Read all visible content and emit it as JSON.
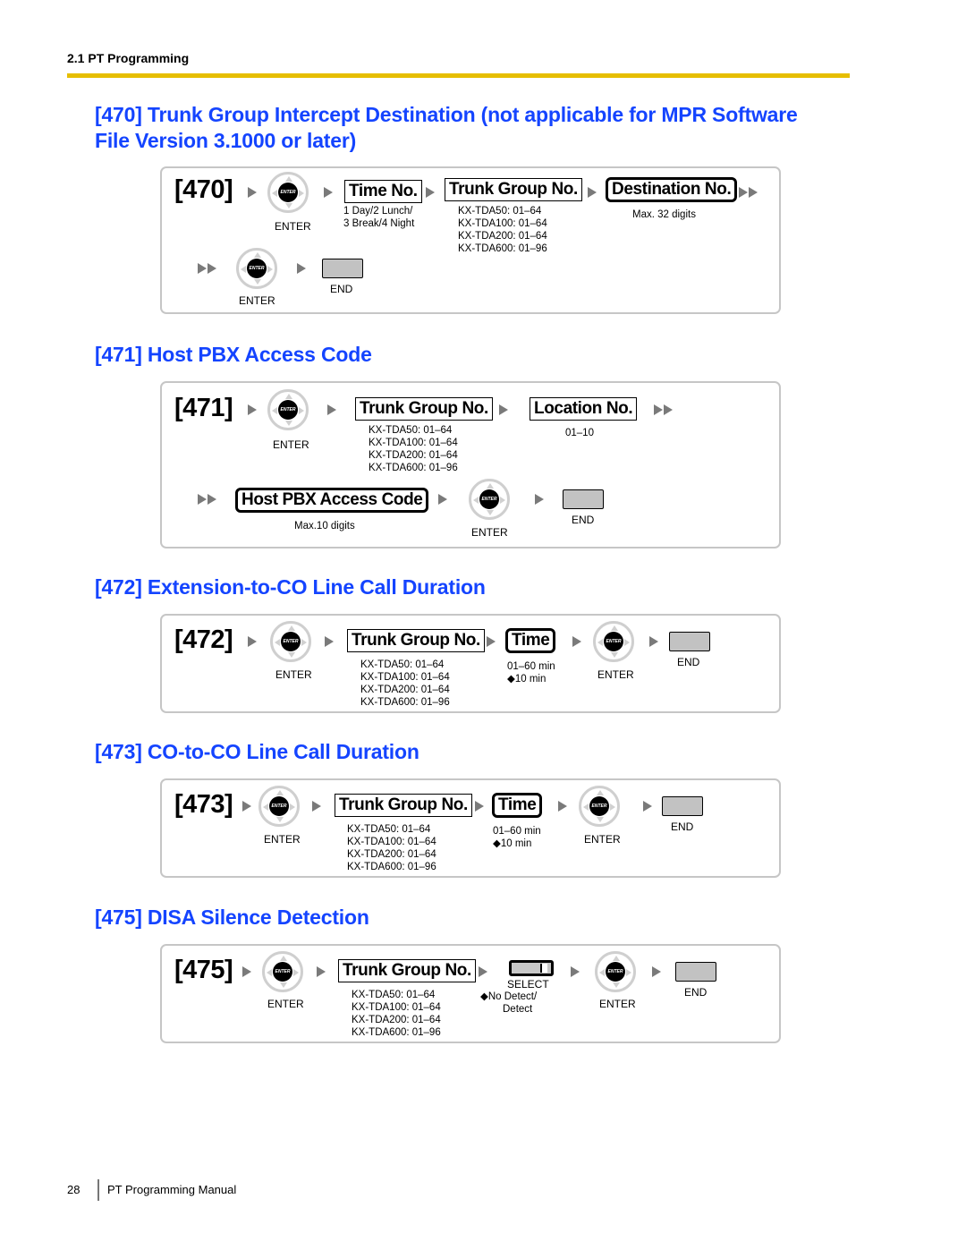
{
  "header": {
    "running_head": "2.1 PT Programming",
    "accent_color": "#e6be00",
    "title_color": "#1444ff"
  },
  "common": {
    "enter": "ENTER",
    "enter_key_glyph": "ENTER",
    "end": "END",
    "trunk_group_no": "Trunk Group No.",
    "trunk_ranges": [
      "KX-TDA50: 01–64",
      "KX-TDA100: 01–64",
      "KX-TDA200: 01–64",
      "KX-TDA600: 01–96"
    ]
  },
  "s470": {
    "title_line1": "[470] Trunk Group Intercept Destination (not applicable for MPR Software",
    "title_line2": "File Version 3.1000 or later)",
    "code": "[470]",
    "time_no": "Time No.",
    "time_no_desc": [
      "1 Day/2 Lunch/",
      "3 Break/4 Night"
    ],
    "destination_no": "Destination No.",
    "destination_desc": "Max. 32 digits"
  },
  "s471": {
    "title": "[471] Host PBX Access Code",
    "code": "[471]",
    "location_no": "Location No.",
    "location_desc": "01–10",
    "host_code": "Host PBX Access Code",
    "host_code_desc": "Max.10 digits"
  },
  "s472": {
    "title": "[472] Extension-to-CO Line Call Duration",
    "code": "[472]",
    "time": "Time",
    "time_desc": [
      "01–60 min",
      "◆10 min"
    ]
  },
  "s473": {
    "title": "[473] CO-to-CO Line Call Duration",
    "code": "[473]",
    "time": "Time",
    "time_desc": [
      "01–60 min",
      "◆10 min"
    ]
  },
  "s475": {
    "title": "[475] DISA Silence Detection",
    "code": "[475]",
    "select": "SELECT",
    "select_desc": [
      "◆No Detect/",
      "Detect"
    ]
  },
  "footer": {
    "page_number": "28",
    "manual_title": "PT Programming Manual"
  }
}
